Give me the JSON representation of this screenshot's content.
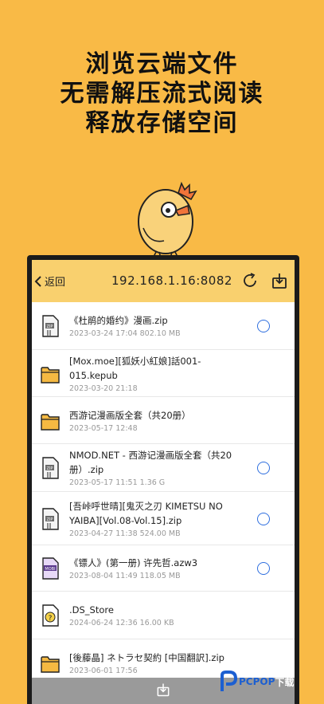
{
  "headline": [
    "浏览云端文件",
    "无需解压流式阅读",
    "释放存储空间"
  ],
  "topbar": {
    "back_label": "返回",
    "address": "192.168.1.16:8082",
    "refresh_icon": "refresh-icon",
    "download_icon": "download-icon"
  },
  "files": [
    {
      "name": "《杜鹃的婚约》漫画.zip",
      "meta": "2023-03-24 17:04  802.10 MB",
      "icon": "zip-file-icon",
      "selectable": true
    },
    {
      "name": "[Mox.moe][狐妖小紅娘]話001-015.kepub",
      "meta": "2023-03-20 21:18",
      "icon": "folder-icon",
      "selectable": false
    },
    {
      "name": "西游记漫画版全套（共20册）",
      "meta": "2023-05-17 12:48",
      "icon": "folder-icon",
      "selectable": false
    },
    {
      "name": "NMOD.NET - 西游记漫画版全套（共20册）.zip",
      "meta": "2023-05-17 11:51  1.36 G",
      "icon": "zip-file-icon",
      "selectable": true
    },
    {
      "name": "[吾峠呼世晴][鬼灭之刃 KIMETSU NO YAIBA][Vol.08-Vol.15].zip",
      "meta": "2023-04-27 11:38  524.00 MB",
      "icon": "zip-file-icon",
      "selectable": true
    },
    {
      "name": "《镖人》(第一册) 许先哲.azw3",
      "meta": "2023-08-04 11:49  118.05 MB",
      "icon": "mobi-file-icon",
      "selectable": true
    },
    {
      "name": ".DS_Store",
      "meta": "2024-06-24 12:36  16.00 KB",
      "icon": "unknown-file-icon",
      "selectable": false
    },
    {
      "name": "[後藤晶] ネトラセ契約 [中国翻訳].zip",
      "meta": "2023-06-01 17:56",
      "icon": "folder-icon",
      "selectable": false
    }
  ],
  "bottombar": {
    "icon": "download-icon"
  },
  "watermark": {
    "brand": "PCPOP",
    "suffix": "下载"
  },
  "colors": {
    "background": "#F9BA46",
    "topbar": "#F9D06E",
    "accent": "#2F6FDF",
    "folder": "#F5B942"
  }
}
